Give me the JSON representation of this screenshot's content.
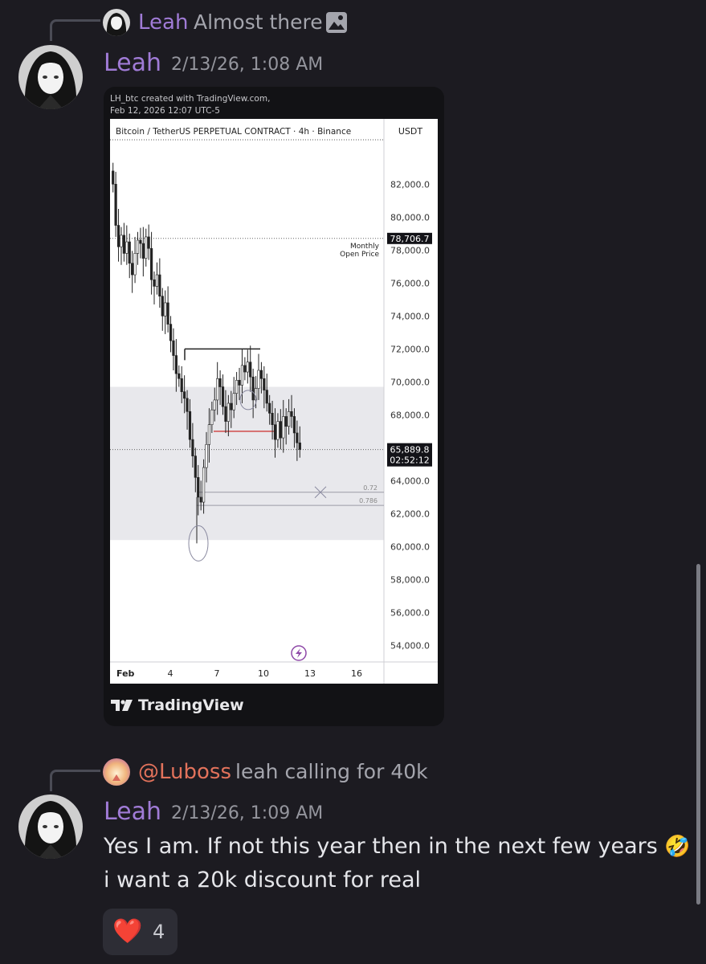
{
  "reply1": {
    "author": "Leah",
    "text": "Almost there"
  },
  "message1": {
    "author": "Leah",
    "timestamp": "2/13/26, 1:08 AM"
  },
  "chart_header": {
    "line1": "LH_btc created with TradingView.com,",
    "line2": "Feb 12, 2026 12:07 UTC-5"
  },
  "chart_data": {
    "type": "candlestick",
    "title": "Bitcoin / TetherUS PERPETUAL CONTRACT · 4h · Binance",
    "currency_label": "USDT",
    "y_ticks": [
      "82,000.0",
      "80,000.0",
      "78,000.0",
      "76,000.0",
      "74,000.0",
      "72,000.0",
      "70,000.0",
      "68,000.0",
      "66,000.0",
      "64,000.0",
      "62,000.0",
      "60,000.0",
      "58,000.0",
      "56,000.0",
      "54,000.0"
    ],
    "x_ticks": [
      "Feb",
      "4",
      "7",
      "10",
      "13",
      "16"
    ],
    "ylim": [
      53000,
      84500
    ],
    "monthly_open": {
      "value": 78706.7,
      "label": "78,706.7",
      "text1": "Monthly",
      "text2": "Open Price"
    },
    "current": {
      "value": 65889.8,
      "label": "65,889.8",
      "countdown": "02:52:12"
    },
    "fib": [
      {
        "label": "0.72",
        "value": 63300
      },
      {
        "label": "0.786",
        "value": 62500
      }
    ],
    "zone": [
      60400,
      69700
    ],
    "resistance": 72000,
    "support_red": 67000,
    "closes": [
      82000,
      79500,
      78200,
      78900,
      77800,
      78500,
      77200,
      76500,
      77800,
      78600,
      78400,
      77500,
      78800,
      78100,
      76200,
      75800,
      76500,
      75200,
      74000,
      74800,
      73500,
      72500,
      71600,
      70500,
      70200,
      69400,
      69000,
      68200,
      66500,
      65500,
      64200,
      63000,
      62700,
      64800,
      66200,
      67400,
      68300,
      68900,
      70200,
      69700,
      68500,
      67600,
      68700,
      68300,
      69300,
      70100,
      69800,
      71000,
      70600,
      71200,
      70300,
      68900,
      69600,
      70700,
      70200,
      69500,
      68700,
      68100,
      67400,
      66500,
      67600,
      66600,
      67900,
      67300,
      68200,
      67900,
      66900,
      66300,
      65900
    ],
    "watermark": "TradingView"
  },
  "reply2": {
    "author": "@Luboss",
    "text": "leah calling for 40k"
  },
  "message2": {
    "author": "Leah",
    "timestamp": "2/13/26, 1:09 AM",
    "line1": "Yes I am. If not this year then in the next few years",
    "emoji": "🤣",
    "line2": "i want a 20k discount for real"
  },
  "reaction": {
    "emoji": "❤️",
    "count": "4"
  },
  "colors": {
    "name": "#a07bd6",
    "luboss": "#e2725b",
    "background": "#1c1b21"
  }
}
